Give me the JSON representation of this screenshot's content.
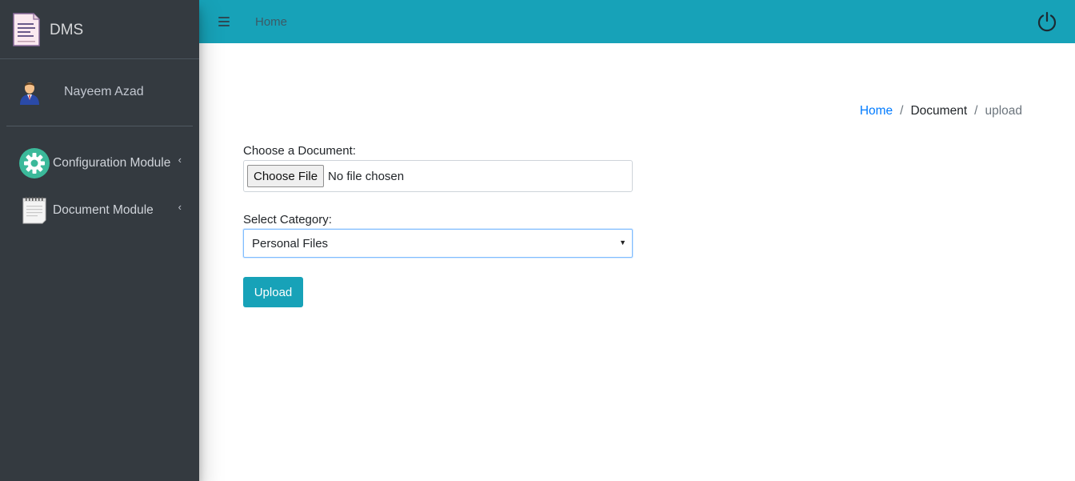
{
  "brand": {
    "name": "DMS",
    "logo_icon": "document-icon"
  },
  "user": {
    "name": "Nayeem Azad",
    "avatar_icon": "businessman-avatar-icon"
  },
  "sidebar": {
    "items": [
      {
        "label": "Configuration Module",
        "icon": "gear-icon",
        "chevron": "‹"
      },
      {
        "label": "Document Module",
        "icon": "notepad-icon",
        "chevron": "‹"
      }
    ]
  },
  "topbar": {
    "menu_icon": "hamburger-icon",
    "home_link": "Home",
    "power_icon": "power-icon",
    "color": "#17a2b8"
  },
  "breadcrumb": {
    "items": [
      "Home",
      "Document",
      "upload"
    ],
    "separator": "/"
  },
  "form": {
    "file_label": "Choose a Document:",
    "file_button": "Choose File",
    "file_status": "No file chosen",
    "category_label": "Select Category:",
    "category_selected": "Personal Files",
    "select_caret": "▼",
    "upload_button": "Upload"
  }
}
